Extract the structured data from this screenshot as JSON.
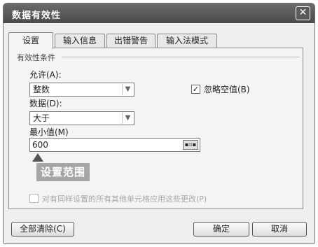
{
  "dialog": {
    "title": "数据有效性",
    "close_glyph": "✕"
  },
  "tabs": [
    "设置",
    "输入信息",
    "出错警告",
    "输入法模式"
  ],
  "settings": {
    "group_title": "有效性条件",
    "allow": {
      "label": "允许(A):",
      "value": "整数"
    },
    "data": {
      "label": "数据(D):",
      "value": "大于"
    },
    "min": {
      "label": "最小值(M)",
      "value": "600"
    },
    "ignore_blank": {
      "label": "忽略空值(B)",
      "checked": true
    },
    "apply_changes_label": "对有同样设置的所有其他单元格应用这些更改(P)"
  },
  "annotation": {
    "text": "设置范围"
  },
  "buttons": {
    "clear_all": "全部清除(C)",
    "ok": "确定",
    "cancel": "取消"
  },
  "icons": {
    "dropdown": "chevron-down-icon",
    "checkmark": "checkmark-icon",
    "range_picker": "range-picker-icon"
  }
}
